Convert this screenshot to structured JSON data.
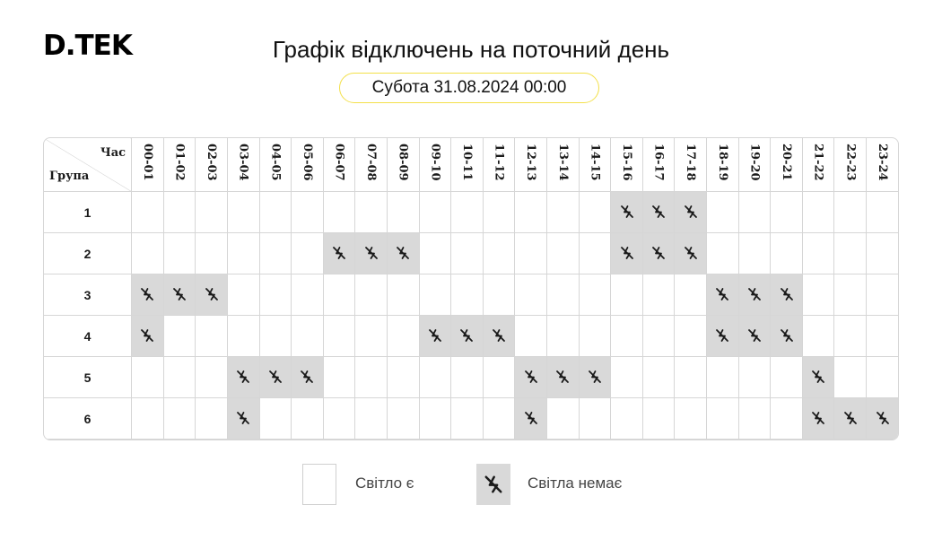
{
  "logo_text": "D.TEK",
  "title": "Графік відключень на поточний день",
  "date_label": "Субота 31.08.2024 00:00",
  "table": {
    "corner_hour_label": "Час",
    "corner_group_label": "Група",
    "hours": [
      "00-01",
      "01-02",
      "02-03",
      "03-04",
      "04-05",
      "05-06",
      "06-07",
      "07-08",
      "08-09",
      "09-10",
      "10-11",
      "11-12",
      "12-13",
      "13-14",
      "14-15",
      "15-16",
      "16-17",
      "17-18",
      "18-19",
      "19-20",
      "20-21",
      "21-22",
      "22-23",
      "23-24"
    ],
    "groups": [
      {
        "label": "1",
        "outage_hours": [
          "15-16",
          "16-17",
          "17-18"
        ]
      },
      {
        "label": "2",
        "outage_hours": [
          "06-07",
          "07-08",
          "08-09",
          "15-16",
          "16-17",
          "17-18"
        ]
      },
      {
        "label": "3",
        "outage_hours": [
          "00-01",
          "01-02",
          "02-03",
          "18-19",
          "19-20",
          "20-21"
        ]
      },
      {
        "label": "4",
        "outage_hours": [
          "00-01",
          "09-10",
          "10-11",
          "11-12",
          "18-19",
          "19-20",
          "20-21"
        ]
      },
      {
        "label": "5",
        "outage_hours": [
          "03-04",
          "04-05",
          "05-06",
          "12-13",
          "13-14",
          "14-15",
          "21-22"
        ]
      },
      {
        "label": "6",
        "outage_hours": [
          "03-04",
          "12-13",
          "21-22",
          "22-23",
          "23-24"
        ]
      }
    ]
  },
  "legend": {
    "power_on_label": "Світло є",
    "power_off_label": "Світла немає",
    "power_off_icon": "no-power-bolt-icon"
  },
  "colors": {
    "outage_fill": "#d9d9d9",
    "date_border": "#f3e04a",
    "grid_border": "#d6d6d6"
  }
}
